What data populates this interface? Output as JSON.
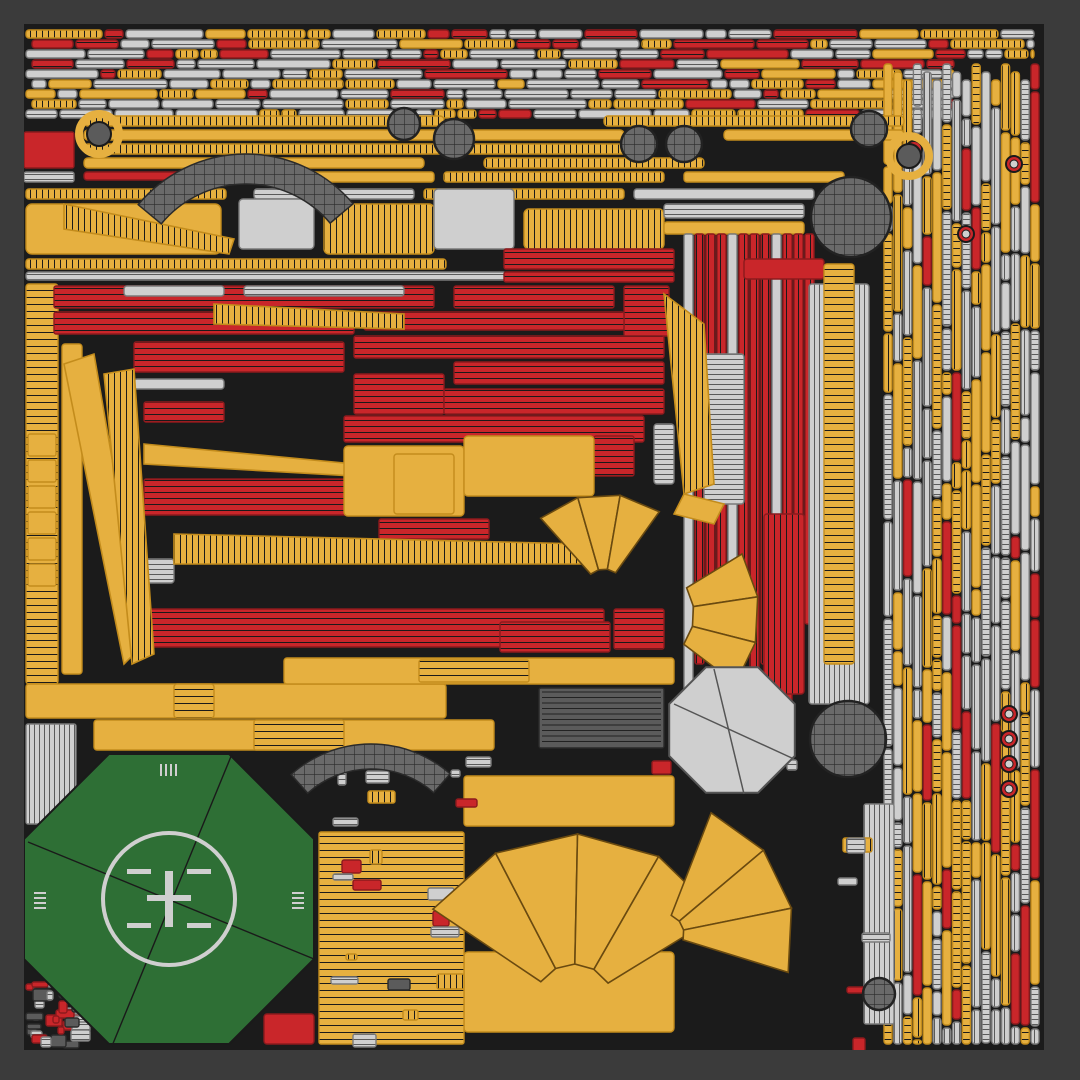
{
  "texture": {
    "colors": {
      "background": "#3b3b3b",
      "sheet": "#1b1b1b",
      "yellow": "#e6b040",
      "yellow_edge": "#c38c1c",
      "red": "#c9262a",
      "red_edge": "#8c1a1d",
      "grey": "#cfcfcf",
      "grey_edge": "#7a7a7a",
      "dark_grey": "#5b5b5b",
      "green": "#2e6f35",
      "outline": "#1a1a1a"
    },
    "helipad": {
      "letter": "H",
      "ring_color": "#cfcfcf",
      "light_icon": "runway-light-icon"
    }
  }
}
